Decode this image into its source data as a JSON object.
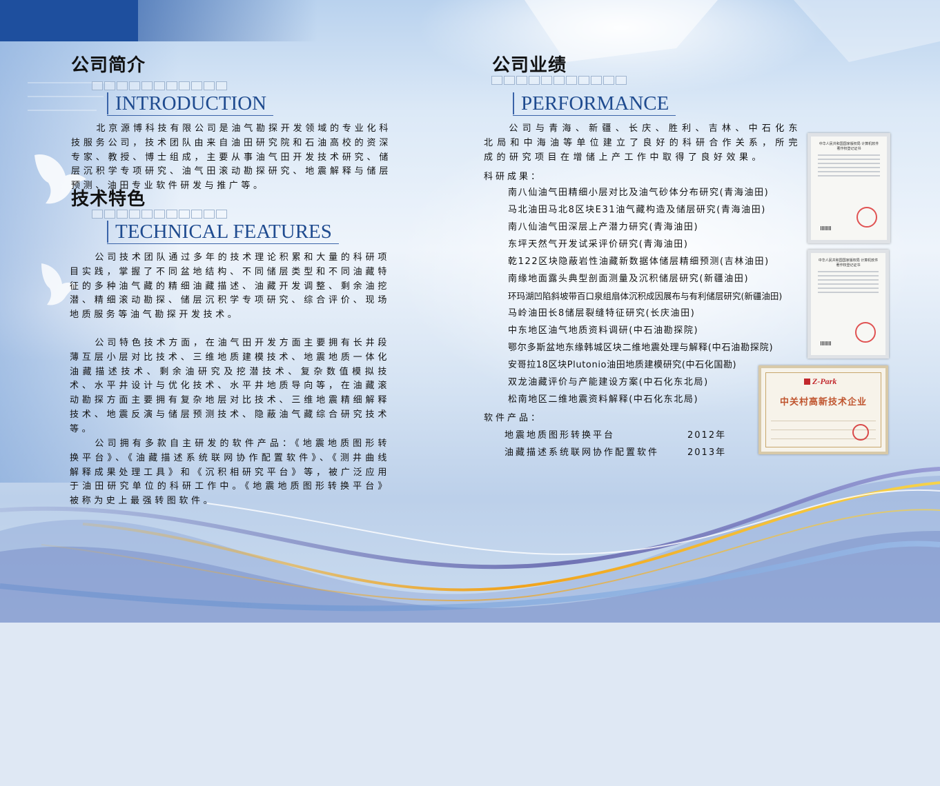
{
  "intro": {
    "title_zh": "公司简介",
    "title_en": "INTRODUCTION",
    "body": "北京源博科技有限公司是油气勘探开发领域的专业化科技服务公司，技术团队由来自油田研究院和石油高校的资深专家、教授、博士组成，主要从事油气田开发技术研究、储层沉积学专项研究、油气田滚动勘探研究、地震解释与储层预测、油田专业软件研发与推广等。"
  },
  "features": {
    "title_zh": "技术特色",
    "title_en": "TECHNICAL FEATURES",
    "paragraphs": [
      "公司技术团队通过多年的技术理论积累和大量的科研项目实践，掌握了不同盆地结构、不同储层类型和不同油藏特征的多种油气藏的精细油藏描述、油藏开发调整、剩余油挖潜、精细滚动勘探、储层沉积学专项研究、综合评价、现场地质服务等油气勘探开发技术。",
      "公司特色技术方面，在油气田开发方面主要拥有长井段薄互层小层对比技术、三维地质建模技术、地震地质一体化油藏描述技术、剩余油研究及挖潜技术、复杂数值模拟技术、水平井设计与优化技术、水平井地质导向等，在油藏滚动勘探方面主要拥有复杂地层对比技术、三维地震精细解释技术、地震反演与储层预测技术、隐蔽油气藏综合研究技术等。",
      "公司拥有多款自主研发的软件产品：《地震地质图形转换平台》、《油藏描述系统联网协作配置软件》、《测井曲线解释成果处理工具》和《沉积相研究平台》等，被广泛应用于油田研究单位的科研工作中。《地震地质图形转换平台》被称为史上最强转图软件。"
    ]
  },
  "performance": {
    "title_zh": "公司业绩",
    "title_en": "PERFORMANCE",
    "body": "公司与青海、新疆、长庆、胜利、吉林、中石化东北局和中海油等单位建立了良好的科研合作关系，所完成的研究项目在增储上产工作中取得了良好效果。",
    "results_label": "科研成果：",
    "results": [
      "南八仙油气田精细小层对比及油气砂体分布研究(青海油田)",
      "马北油田马北8区块E31油气藏构造及储层研究(青海油田)",
      "南八仙油气田深层上产潜力研究(青海油田)",
      "东坪天然气开发试采评价研究(青海油田)",
      "乾122区块隐蔽岩性油藏新数据体储层精细预测(吉林油田)",
      "南缘地面露头典型剖面测量及沉积储层研究(新疆油田)",
      "环玛湖凹陷斜坡带百口泉组扇体沉积成因展布与有利储层研究(新疆油田)",
      "马岭油田长8储层裂缝特征研究(长庆油田)",
      "中东地区油气地质资料调研(中石油勘探院)",
      "鄂尔多斯盆地东缘韩城区块二维地震处理与解释(中石油勘探院)",
      "安哥拉18区块Plutonio油田地质建模研究(中石化国勘)",
      "双龙油藏评价与产能建设方案(中石化东北局)",
      "松南地区二维地震资料解释(中石化东北局)"
    ],
    "software_label": "软件产品：",
    "software": [
      {
        "name": "地震地质图形转换平台",
        "year": "2012年"
      },
      {
        "name": "油藏描述系统联网协作配置软件",
        "year": "2013年"
      }
    ]
  },
  "certificates": {
    "cert1_title": "中华人民共和国国家版权局 计算机软件著作权登记证书",
    "cert2_title": "中华人民共和国国家版权局 计算机软件著作权登记证书",
    "award_logo": "Z-Park",
    "award_title": "中关村高新技术企业"
  },
  "colors": {
    "accent_blue": "#1f4b8f",
    "corner_blue": "#1e4f9e",
    "award_title": "#c0552f"
  }
}
